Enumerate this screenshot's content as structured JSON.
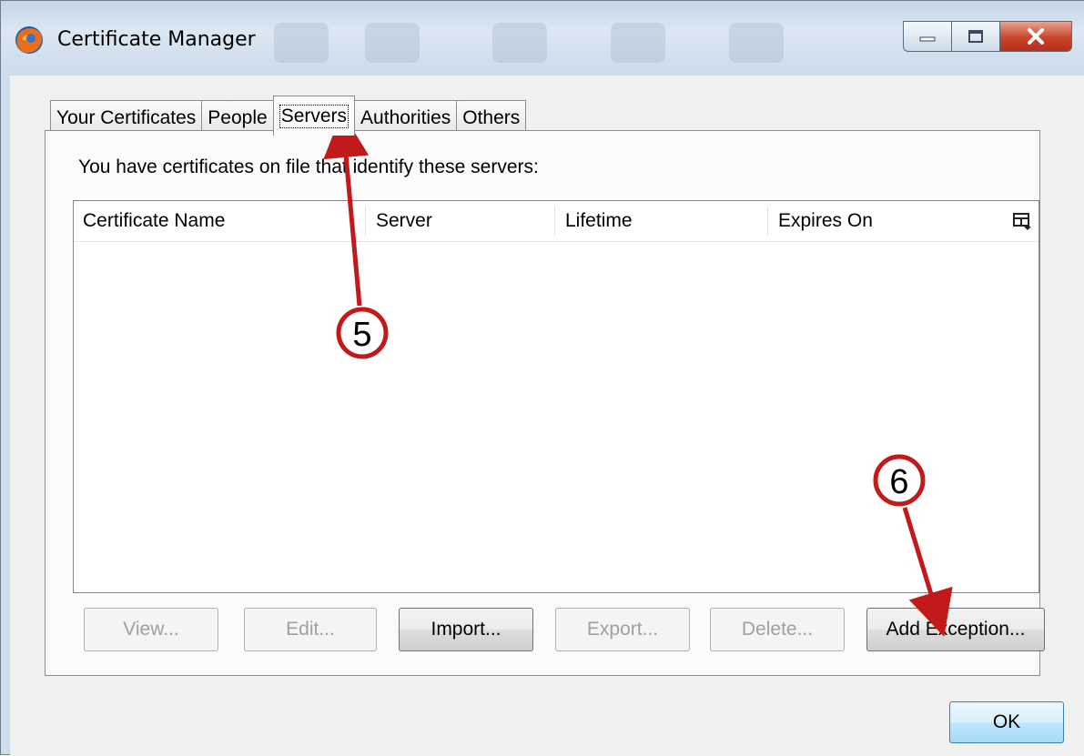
{
  "window": {
    "title": "Certificate Manager",
    "icon": "firefox-icon",
    "controls": [
      "minimize-icon",
      "maximize-icon",
      "close-icon"
    ]
  },
  "tabs": [
    {
      "label": "Your Certificates",
      "active": false
    },
    {
      "label": "People",
      "active": false
    },
    {
      "label": "Servers",
      "active": true
    },
    {
      "label": "Authorities",
      "active": false
    },
    {
      "label": "Others",
      "active": false
    }
  ],
  "panel": {
    "intro": "You have certificates on file that identify these servers:",
    "columns": [
      "Certificate Name",
      "Server",
      "Lifetime",
      "Expires On"
    ],
    "rows": []
  },
  "buttons": {
    "view": {
      "label": "View...",
      "enabled": false
    },
    "edit": {
      "label": "Edit...",
      "enabled": false
    },
    "import": {
      "label": "Import...",
      "enabled": true
    },
    "export": {
      "label": "Export...",
      "enabled": false
    },
    "delete": {
      "label": "Delete...",
      "enabled": false
    },
    "add_exception": {
      "label": "Add Exception...",
      "enabled": true
    }
  },
  "ok_label": "OK",
  "annotations": [
    {
      "number": "5",
      "points_to": "Servers tab"
    },
    {
      "number": "6",
      "points_to": "Add Exception button"
    }
  ],
  "colors": {
    "arrow": "#c21a1a",
    "ok_border": "#3c7fb1",
    "close": "#c9452b"
  }
}
